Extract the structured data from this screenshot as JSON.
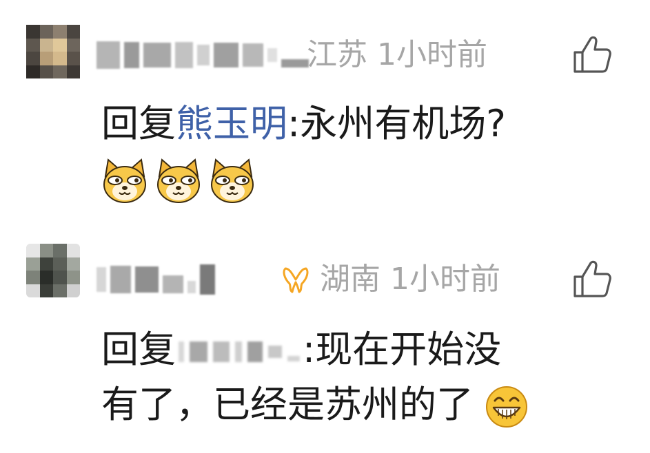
{
  "comments": [
    {
      "location": "江苏",
      "time": "1小时前",
      "reply_prefix": "回复",
      "mention": "熊玉明",
      "text": ":永州有机场?",
      "emojis": [
        "doge-emoji",
        "doge-emoji",
        "doge-emoji"
      ]
    },
    {
      "location": "湖南",
      "time": "1小时前",
      "reply_prefix": "回复",
      "text_line1": ":现在开始没",
      "text_line2": "有了，已经是苏州的了",
      "trailing_emoji": "grin-emoji",
      "badge_icon": "vip-ribbon-icon",
      "badge_color": "#f5a623"
    }
  ],
  "colors": {
    "meta": "#a6a6a6",
    "mention": "#3f61a8",
    "text": "#1a1a1a"
  }
}
